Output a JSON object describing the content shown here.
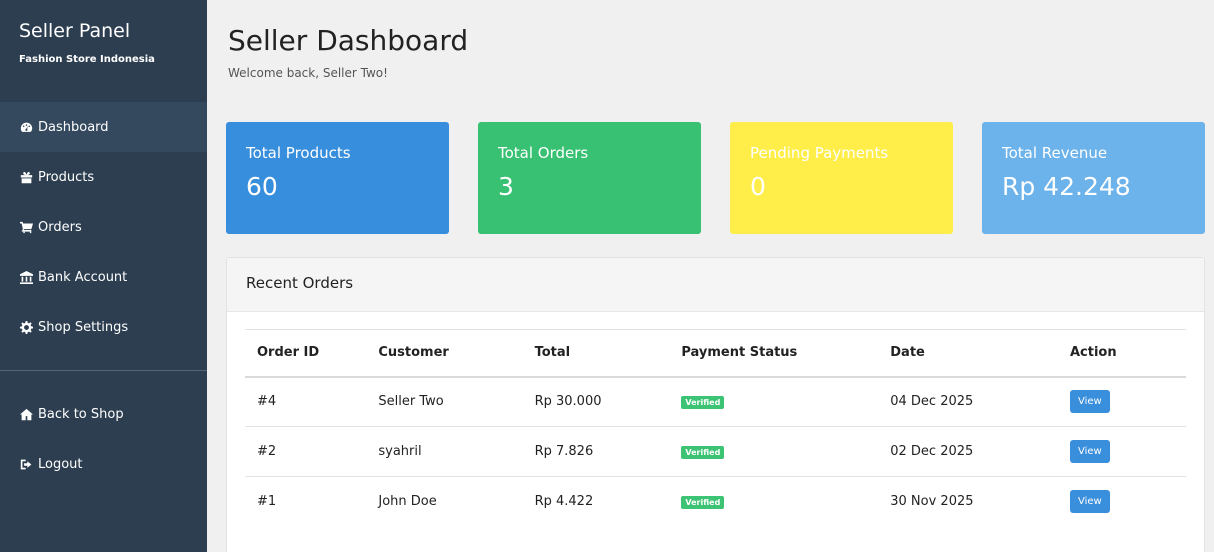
{
  "sidebar": {
    "title": "Seller Panel",
    "subtitle": "Fashion Store Indonesia",
    "items": [
      {
        "label": "Dashboard",
        "icon": "dashboard-icon"
      },
      {
        "label": "Products",
        "icon": "products-icon"
      },
      {
        "label": "Orders",
        "icon": "cart-icon"
      },
      {
        "label": "Bank Account",
        "icon": "bank-icon"
      },
      {
        "label": "Shop Settings",
        "icon": "gear-icon"
      }
    ],
    "bottom_items": [
      {
        "label": "Back to Shop",
        "icon": "home-icon"
      },
      {
        "label": "Logout",
        "icon": "logout-icon"
      }
    ]
  },
  "header": {
    "title": "Seller Dashboard",
    "welcome": "Welcome back, Seller Two!"
  },
  "stats": [
    {
      "label": "Total Products",
      "value": "60",
      "color": "#378edd"
    },
    {
      "label": "Total Orders",
      "value": "3",
      "color": "#38c172"
    },
    {
      "label": "Pending Payments",
      "value": "0",
      "color": "#ffed4a"
    },
    {
      "label": "Total Revenue",
      "value": "Rp 42.248",
      "color": "#6cb2eb"
    }
  ],
  "recent_orders": {
    "title": "Recent Orders",
    "columns": [
      "Order ID",
      "Customer",
      "Total",
      "Payment Status",
      "Date",
      "Action"
    ],
    "rows": [
      {
        "id": "#4",
        "customer": "Seller Two",
        "total": "Rp 30.000",
        "status": "Verified",
        "date": "04 Dec 2025",
        "action": "View"
      },
      {
        "id": "#2",
        "customer": "syahril",
        "total": "Rp 7.826",
        "status": "Verified",
        "date": "02 Dec 2025",
        "action": "View"
      },
      {
        "id": "#1",
        "customer": "John Doe",
        "total": "Rp 4.422",
        "status": "Verified",
        "date": "30 Nov 2025",
        "action": "View"
      }
    ]
  }
}
